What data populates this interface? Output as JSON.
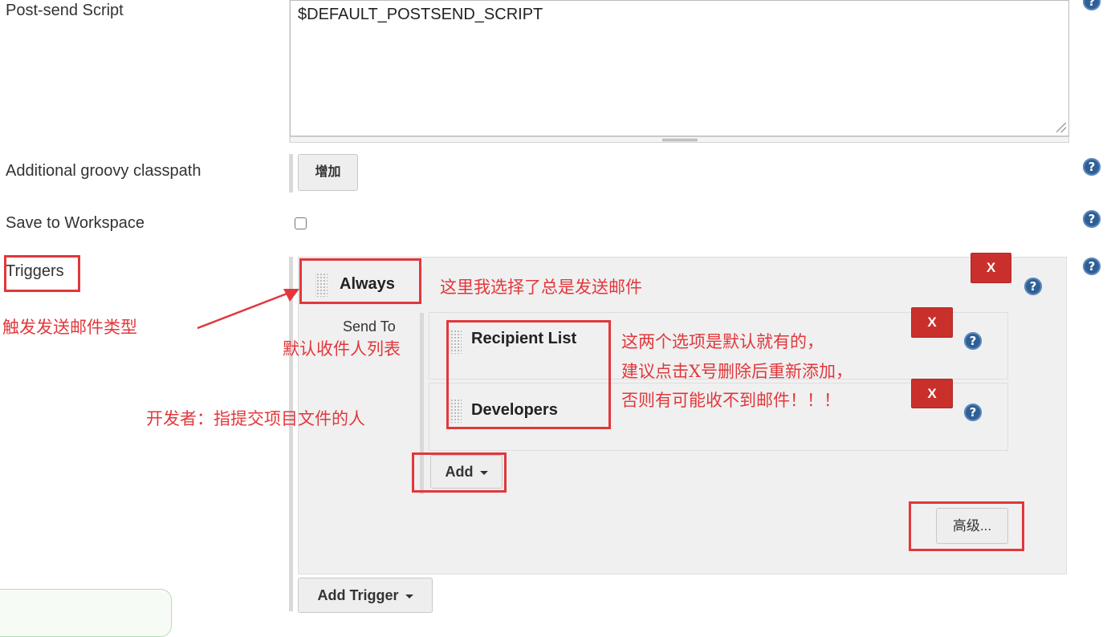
{
  "form": {
    "postsend_label": "Post-send Script",
    "postsend_value": "$DEFAULT_POSTSEND_SCRIPT",
    "groovy_label": "Additional groovy classpath",
    "groovy_add_button": "增加",
    "save_label": "Save to Workspace",
    "save_checked": false,
    "triggers_label": "Triggers"
  },
  "trigger": {
    "name": "Always",
    "remove_label": "X",
    "send_to_label": "Send To",
    "recipients": [
      {
        "name": "Recipient List",
        "remove_label": "X"
      },
      {
        "name": "Developers",
        "remove_label": "X"
      }
    ],
    "add_button": "Add",
    "advanced_button": "高级..."
  },
  "add_trigger_button": "Add Trigger",
  "help_icon_glyph": "?",
  "annotations": {
    "trigger_type": "触发发送邮件类型",
    "always_note": "这里我选择了总是发送邮件",
    "default_recipients": "默认收件人列表",
    "developers_note": "开发者：指提交项目文件的人",
    "defaults_note_1": "这两个选项是默认就有的，",
    "defaults_note_2": "建议点击X号删除后重新添加，",
    "defaults_note_3": "否则有可能收不到邮件！！！"
  },
  "colors": {
    "annotation_red": "#e2373b",
    "remove_button_red": "#c9302c",
    "help_icon_blue": "#2e5f95"
  }
}
